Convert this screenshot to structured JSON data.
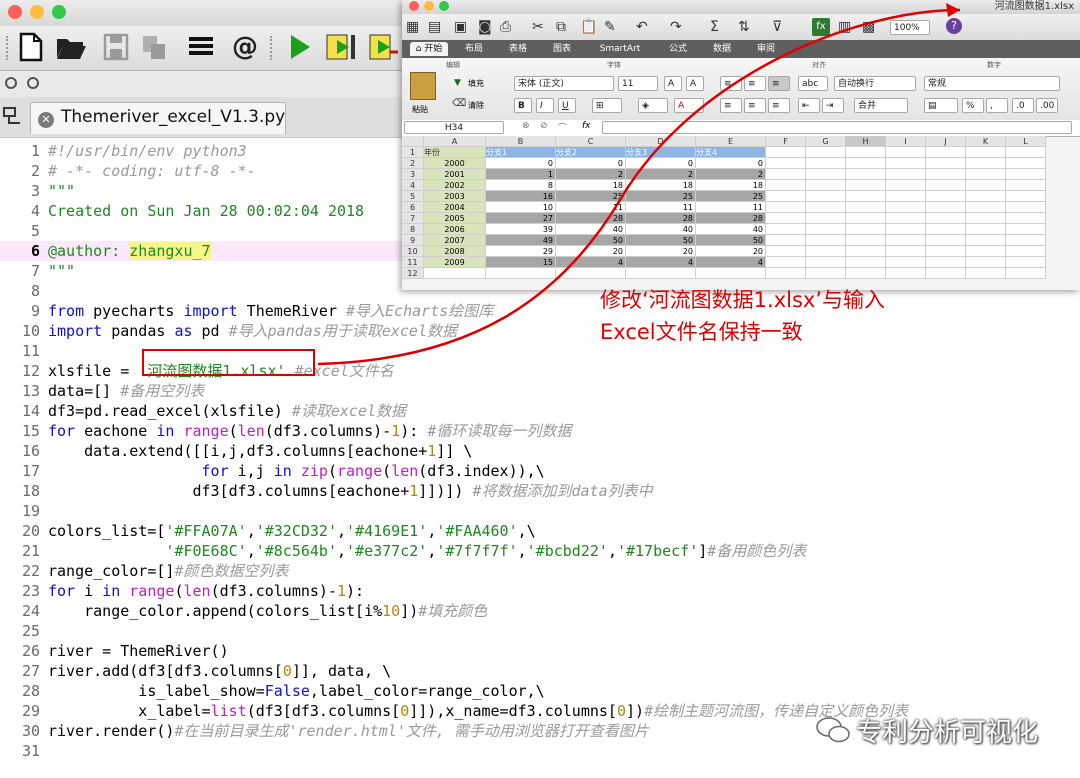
{
  "editor": {
    "file_tab": "Themeriver_excel_V1.3.py",
    "current_line": 6,
    "lines": [
      {
        "n": "1",
        "html": "<span class=\"c\">#!/usr/bin/env python3</span>"
      },
      {
        "n": "2",
        "html": "<span class=\"c\"># -*- coding: utf-8 -*-</span>"
      },
      {
        "n": "3",
        "html": "<span class=\"s\">\"\"\"</span>"
      },
      {
        "n": "4",
        "html": "<span class=\"s\">Created on Sun Jan 28 00:02:04 2018</span>"
      },
      {
        "n": "5",
        "html": ""
      },
      {
        "n": "6",
        "html": "<span class=\"s\">@author: zhangxu_7</span>"
      },
      {
        "n": "7",
        "html": "<span class=\"s\">\"\"\"</span>"
      },
      {
        "n": "8",
        "html": ""
      },
      {
        "n": "9",
        "html": "<span class=\"k\">from</span> pyecharts <span class=\"k\">import</span> ThemeRiver <span class=\"c\">#导入Echarts绘图库</span>"
      },
      {
        "n": "10",
        "html": "<span class=\"k\">import</span> pandas <span class=\"k\">as</span> pd <span class=\"c\">#导入pandas用于读取excel数据</span>"
      },
      {
        "n": "11",
        "html": ""
      },
      {
        "n": "12",
        "html": "xlsfile = <span class=\"s\">'河流图数据1.xlsx'</span> <span class=\"c\">#excel文件名</span>"
      },
      {
        "n": "13",
        "html": "data=[] <span class=\"c\">#备用空列表</span>"
      },
      {
        "n": "14",
        "html": "df3=pd.read_excel(xlsfile) <span class=\"c\">#读取excel数据</span>"
      },
      {
        "n": "15",
        "html": "<span class=\"k\">for</span> eachone <span class=\"k\">in</span> <span class=\"f\">range</span>(<span class=\"f\">len</span>(df3.columns)-<span class=\"n\">1</span>): <span class=\"c\">#循环读取每一列数据</span>"
      },
      {
        "n": "16",
        "html": "    data.extend([[i,j,df3.columns[eachone+<span class=\"n\">1</span>]] \\"
      },
      {
        "n": "17",
        "html": "                 <span class=\"k\">for</span> i,j <span class=\"k\">in</span> <span class=\"f\">zip</span>(<span class=\"f\">range</span>(<span class=\"f\">len</span>(df3.index)),\\"
      },
      {
        "n": "18",
        "html": "                df3[df3.columns[eachone+<span class=\"n\">1</span>]])]) <span class=\"c\">#将数据添加到data列表中</span>"
      },
      {
        "n": "19",
        "html": ""
      },
      {
        "n": "20",
        "html": "colors_list=[<span class=\"s\">'#FFA07A'</span>,<span class=\"s\">'#32CD32'</span>,<span class=\"s\">'#4169E1'</span>,<span class=\"s\">'#FAA460'</span>,\\"
      },
      {
        "n": "21",
        "html": "             <span class=\"s\">'#F0E68C'</span>,<span class=\"s\">'#8c564b'</span>,<span class=\"s\">'#e377c2'</span>,<span class=\"s\">'#7f7f7f'</span>,<span class=\"s\">'#bcbd22'</span>,<span class=\"s\">'#17becf'</span>]<span class=\"c\">#备用颜色列表</span>"
      },
      {
        "n": "22",
        "html": "range_color=[]<span class=\"c\">#颜色数据空列表</span>"
      },
      {
        "n": "23",
        "html": "<span class=\"k\">for</span> i <span class=\"k\">in</span> <span class=\"f\">range</span>(<span class=\"f\">len</span>(df3.columns)-<span class=\"n\">1</span>):"
      },
      {
        "n": "24",
        "html": "    range_color.append(colors_list[i%<span class=\"n\">10</span>])<span class=\"c\">#填充颜色</span>"
      },
      {
        "n": "25",
        "html": ""
      },
      {
        "n": "26",
        "html": "river = ThemeRiver()"
      },
      {
        "n": "27",
        "html": "river.add(df3[df3.columns[<span class=\"n\">0</span>]], data, \\"
      },
      {
        "n": "28",
        "html": "          is_label_show=<span class=\"k\">False</span>,label_color=range_color,\\"
      },
      {
        "n": "29",
        "html": "          x_label=<span class=\"f\">list</span>(df3[df3.columns[<span class=\"n\">0</span>]]),x_name=df3.columns[<span class=\"n\">0</span>])<span class=\"c\">#绘制主题河流图，传递自定义颜色列表</span>"
      },
      {
        "n": "30",
        "html": "river.render()<span class=\"c\">#在当前目录生成'render.html'文件, 需手动用浏览器打开查看图片</span>"
      },
      {
        "n": "31",
        "html": ""
      }
    ]
  },
  "excel": {
    "file_name": "河流图数据1.xlsx",
    "zoom": "100%",
    "ribbon_tabs": [
      "开始",
      "布局",
      "表格",
      "图表",
      "SmartArt",
      "公式",
      "数据",
      "审阅"
    ],
    "ribbon_groups": [
      "编辑",
      "字体",
      "对齐",
      "数字"
    ],
    "paste_label": "粘贴",
    "fill_label": "填充",
    "clear_label": "清除",
    "font_name": "宋体 (正文)",
    "font_size": "11",
    "wrap_label": "自动换行",
    "merge_label": "合并",
    "number_format": "常规",
    "cell_ref": "H34",
    "fx": "fx",
    "col_letters": [
      "A",
      "B",
      "C",
      "D",
      "E",
      "F",
      "G",
      "H",
      "I",
      "J",
      "K",
      "L"
    ],
    "headers": [
      "年份",
      "分支1",
      "分支2",
      "分支3",
      "分支4"
    ],
    "rows": [
      [
        "2000",
        "0",
        "0",
        "0",
        "0"
      ],
      [
        "2001",
        "1",
        "2",
        "2",
        "2"
      ],
      [
        "2002",
        "8",
        "18",
        "18",
        "18"
      ],
      [
        "2003",
        "16",
        "25",
        "25",
        "25"
      ],
      [
        "2004",
        "10",
        "11",
        "11",
        "11"
      ],
      [
        "2005",
        "27",
        "28",
        "28",
        "28"
      ],
      [
        "2006",
        "39",
        "40",
        "40",
        "40"
      ],
      [
        "2007",
        "49",
        "50",
        "50",
        "50"
      ],
      [
        "2008",
        "29",
        "20",
        "20",
        "20"
      ],
      [
        "2009",
        "15",
        "4",
        "4",
        "4"
      ]
    ]
  },
  "annotation": {
    "line1": "修改‘河流图数据1.xlsx’与输入",
    "line2": "Excel文件名保持一致"
  },
  "watermark": "专利分析可视化",
  "colors": {
    "annotation_red": "#e00000",
    "keyword_blue": "#1010d0",
    "string_green": "#208820",
    "comment_gray": "#9a9a9a",
    "header_blue": "#8db4e2",
    "year_green": "#d8e4bc",
    "shaded_gray": "#a6a6a6"
  }
}
